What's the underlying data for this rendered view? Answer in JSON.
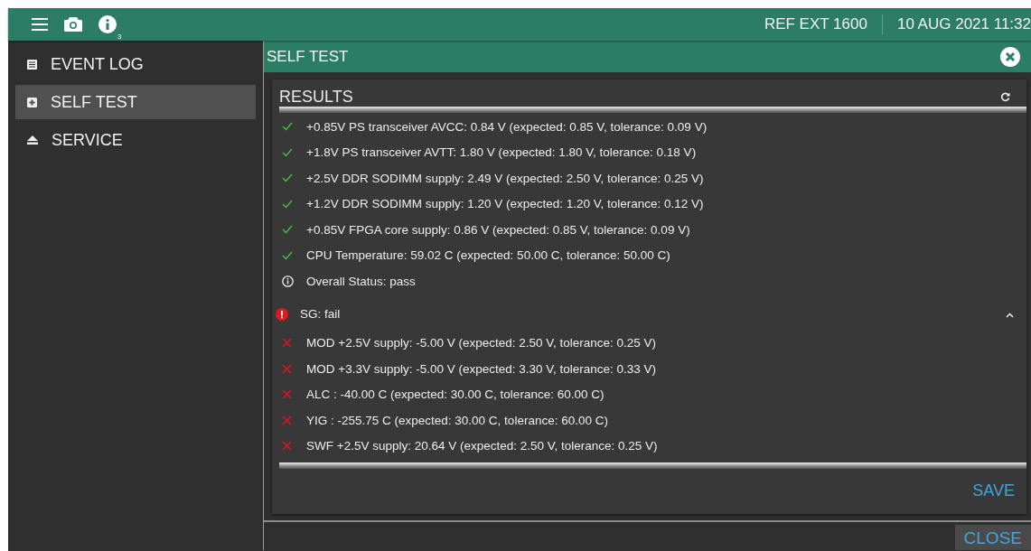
{
  "topbar": {
    "info_count": "3",
    "reference": "REF EXT 1600",
    "datetime": "10 AUG 2021 11:32"
  },
  "sidebar": {
    "items": [
      {
        "kind": "log",
        "label": "EVENT LOG",
        "selected": false
      },
      {
        "kind": "test",
        "label": "SELF TEST",
        "selected": true
      },
      {
        "kind": "service",
        "label": "SERVICE",
        "selected": false
      }
    ]
  },
  "dialog": {
    "title": "SELF TEST",
    "results": {
      "title": "RESULTS",
      "items": [
        {
          "kind": "pass",
          "text": "+0.85V PS transceiver AVCC: 0.84 V (expected: 0.85 V, tolerance: 0.09 V)"
        },
        {
          "kind": "pass",
          "text": "+1.8V PS transceiver AVTT: 1.80 V (expected: 1.80 V, tolerance: 0.18 V)"
        },
        {
          "kind": "pass",
          "text": "+2.5V DDR SODIMM supply: 2.49 V (expected: 2.50 V, tolerance: 0.25 V)"
        },
        {
          "kind": "pass",
          "text": "+1.2V DDR SODIMM supply: 1.20 V (expected: 1.20 V, tolerance: 0.12 V)"
        },
        {
          "kind": "pass",
          "text": "+0.85V FPGA core supply: 0.86 V (expected: 0.85 V, tolerance: 0.09 V)"
        },
        {
          "kind": "pass",
          "text": "CPU Temperature: 59.02 C (expected: 50.00 C, tolerance: 50.00 C)"
        },
        {
          "kind": "info",
          "text": "Overall Status: pass"
        },
        {
          "kind": "group",
          "text": "SG: fail",
          "expanded": true
        },
        {
          "kind": "fail",
          "text": "MOD +2.5V supply: -5.00 V (expected: 2.50 V, tolerance: 0.25 V)"
        },
        {
          "kind": "fail",
          "text": "MOD +3.3V supply: -5.00 V (expected: 3.30 V, tolerance: 0.33 V)"
        },
        {
          "kind": "fail",
          "text": "ALC : -40.00 C (expected: 30.00 C, tolerance: 60.00 C)"
        },
        {
          "kind": "fail",
          "text": "YIG : -255.75 C (expected: 30.00 C, tolerance: 60.00 C)"
        },
        {
          "kind": "fail",
          "text": "SWF +2.5V supply: 20.64 V (expected: 2.50 V, tolerance: 0.25 V)"
        }
      ]
    },
    "save_label": "SAVE"
  },
  "close_label": "CLOSE"
}
